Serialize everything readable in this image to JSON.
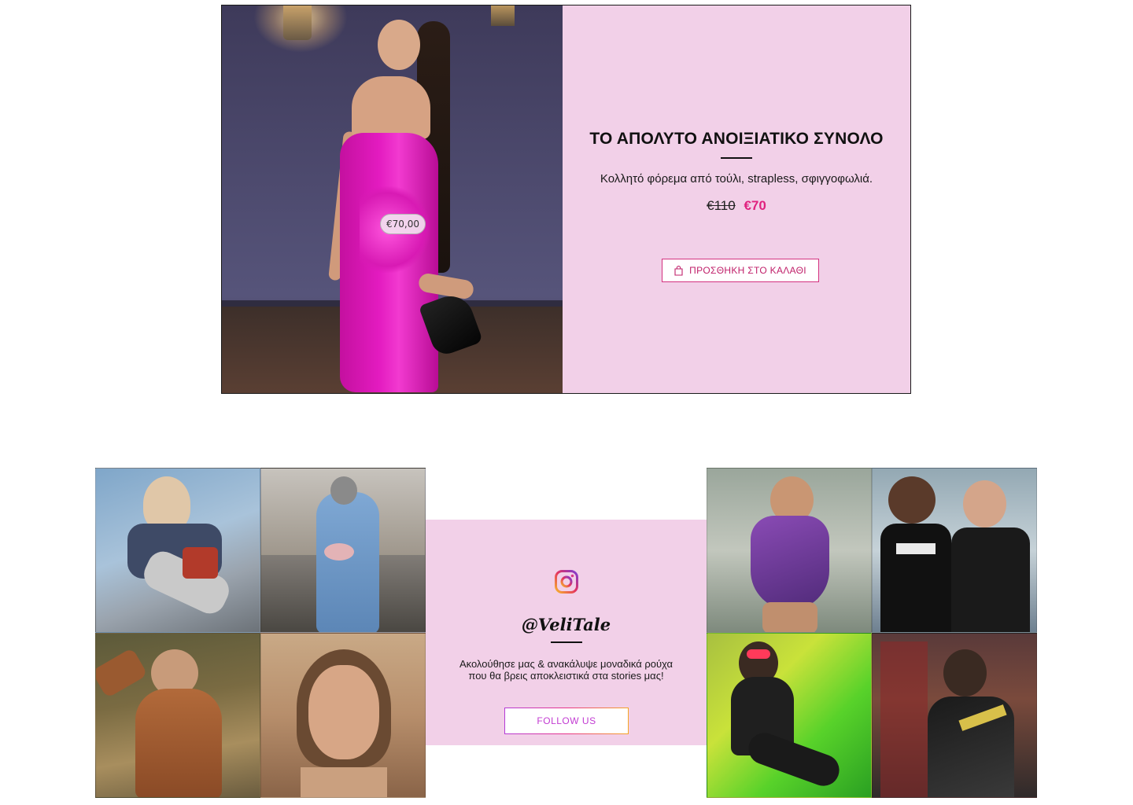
{
  "promo": {
    "image_price_tag": "€70,00",
    "title": "ΤΟ ΑΠΟΛΥΤΟ ΑΝΟΙΞΙΑΤΙΚΟ ΣΥΝΟΛΟ",
    "description": "Κολλητό φόρεμα από τούλι, strapless, σφιγγοφωλιά.",
    "price_old": "€110",
    "price_new": "€70",
    "cart_button_label": "ΠΡΟΣΘΗΚΗ ΣΤΟ ΚΑΛΑΘΙ",
    "colors": {
      "panel": "#f2d0e8",
      "accent": "#e0227f"
    }
  },
  "instagram": {
    "icon": "instagram-icon",
    "handle": "@VeliTale",
    "text_line1": "Ακολούθησε μας & ανακάλυψε μοναδικά ρούχα",
    "text_line2": "που θα βρεις αποκλειστικά στα stories μας!",
    "follow_label": "FOLLOW US"
  }
}
